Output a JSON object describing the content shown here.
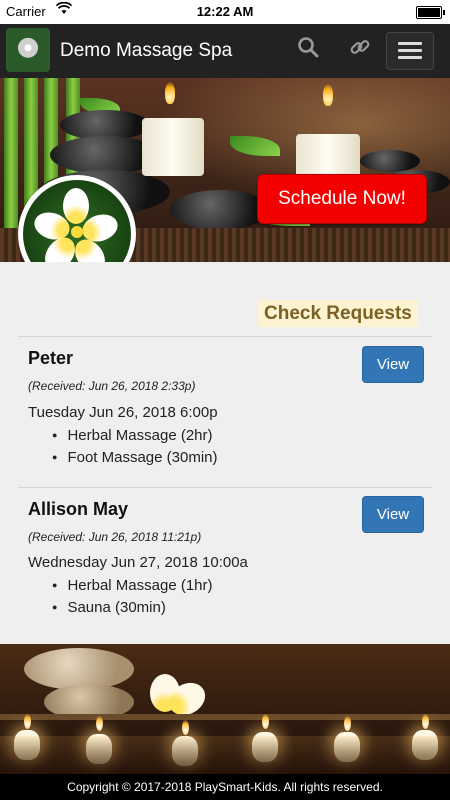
{
  "status_bar": {
    "carrier": "Carrier",
    "time": "12:22 AM"
  },
  "navbar": {
    "brand": "Demo Massage Spa",
    "search_icon": "search-icon",
    "link_icon": "link-icon",
    "menu_icon": "hamburger-menu-icon"
  },
  "hero": {
    "schedule_label": "Schedule Now!"
  },
  "content": {
    "section_title": "Check Requests",
    "requests": [
      {
        "name": "Peter",
        "received": "(Received: Jun 26, 2018 2:33p)",
        "datetime": "Tuesday Jun 26, 2018 6:00p",
        "services": [
          "Herbal Massage (2hr)",
          "Foot Massage (30min)"
        ],
        "view_label": "View"
      },
      {
        "name": "Allison May",
        "received": "(Received: Jun 26, 2018 11:21p)",
        "datetime": "Wednesday Jun 27, 2018 10:00a",
        "services": [
          "Herbal Massage (1hr)",
          "Sauna (30min)"
        ],
        "view_label": "View"
      }
    ]
  },
  "footer": {
    "copyright": "Copyright © 2017-2018 PlaySmart-Kids. All rights reserved."
  },
  "colors": {
    "navbar": "#222222",
    "schedule_button": "#f50000",
    "view_button": "#3376b5",
    "section_title_bg": "#fdf3d0",
    "section_title_text": "#7a6225"
  }
}
